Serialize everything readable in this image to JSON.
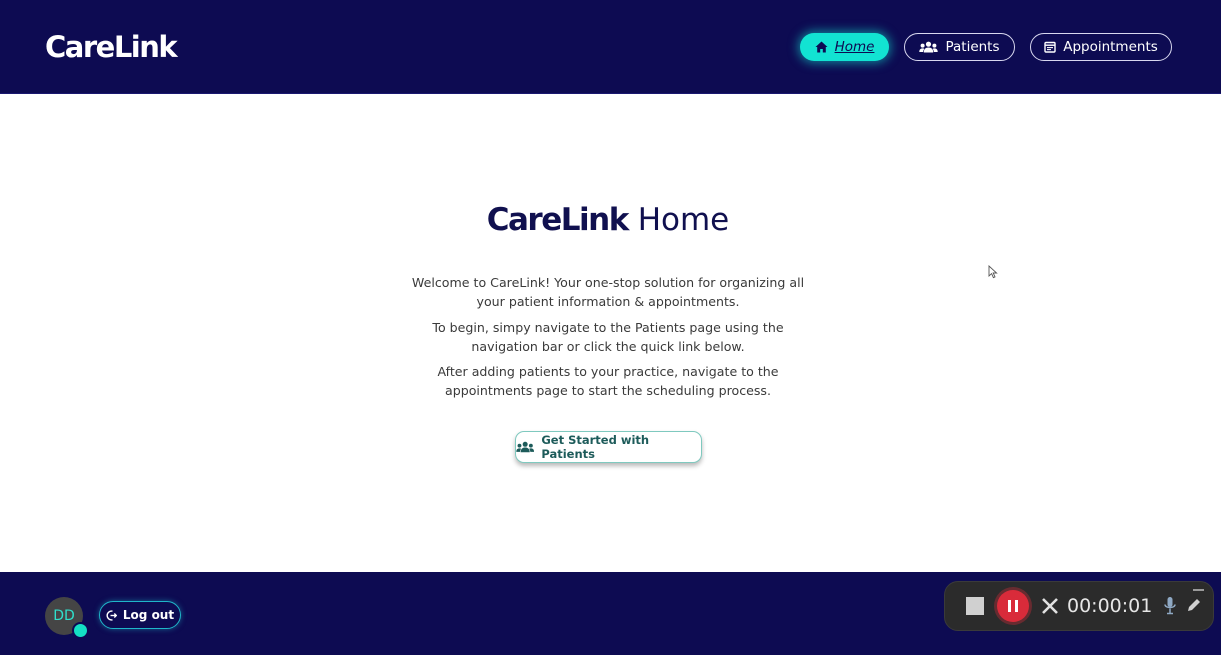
{
  "header": {
    "brand": "CareLink",
    "nav": [
      {
        "label": "Home",
        "icon": "home-icon",
        "active": true
      },
      {
        "label": "Patients",
        "icon": "users-icon",
        "active": false
      },
      {
        "label": "Appointments",
        "icon": "calendar-icon",
        "active": false
      }
    ]
  },
  "main": {
    "title_brand": "CareLink",
    "title_suffix": "Home",
    "paragraphs": [
      "Welcome to CareLink! Your one-stop solution for organizing all your patient information & appointments.",
      "To begin, simpy navigate to the Patients page using the navigation bar or click the quick link below.",
      "After adding patients to your practice, navigate to the appointments page to start the scheduling process."
    ],
    "cta_label": "Get Started with Patients"
  },
  "footer": {
    "avatar_initials": "DD",
    "logout_label": "Log out"
  },
  "recorder": {
    "time": "00:00:01"
  },
  "colors": {
    "navy": "#0d0b52",
    "accent": "#12e3d2",
    "record_red": "#d92b3a"
  }
}
